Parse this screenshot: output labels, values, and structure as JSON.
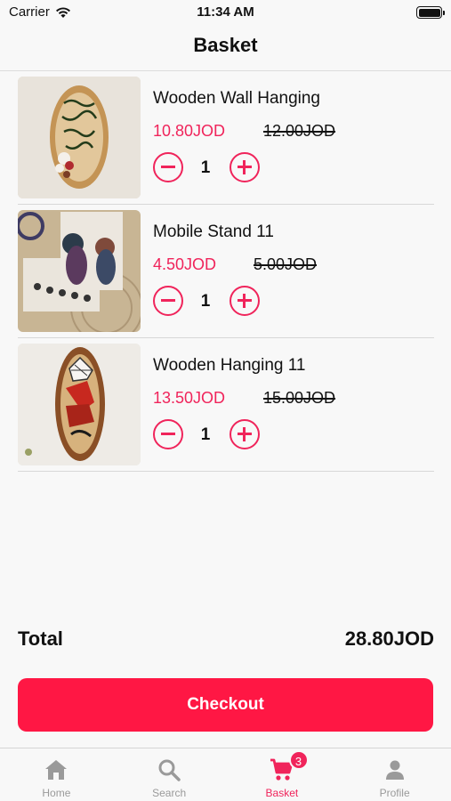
{
  "status_bar": {
    "carrier": "Carrier",
    "time": "11:34 AM"
  },
  "header": {
    "title": "Basket"
  },
  "items": [
    {
      "name": "Wooden Wall Hanging",
      "price": "10.80JOD",
      "old_price": "12.00JOD",
      "quantity": "1"
    },
    {
      "name": "Mobile Stand 11",
      "price": "4.50JOD",
      "old_price": "5.00JOD",
      "quantity": "1"
    },
    {
      "name": "Wooden Hanging 11",
      "price": "13.50JOD",
      "old_price": "15.00JOD",
      "quantity": "1"
    }
  ],
  "summary": {
    "total_label": "Total",
    "total_value": "28.80JOD"
  },
  "checkout": {
    "label": "Checkout"
  },
  "tabs": [
    {
      "label": "Home",
      "icon": "home-icon"
    },
    {
      "label": "Search",
      "icon": "search-icon"
    },
    {
      "label": "Basket",
      "icon": "cart-icon",
      "badge": "3",
      "active": true
    },
    {
      "label": "Profile",
      "icon": "person-icon"
    }
  ],
  "colors": {
    "accent": "#f0245b",
    "checkout": "#ff1744",
    "inactive_tab": "#9a9a9a"
  }
}
